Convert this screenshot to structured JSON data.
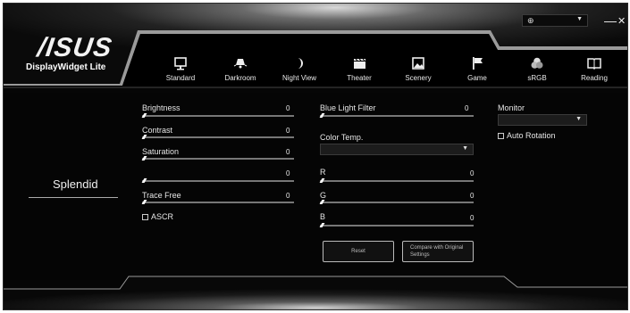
{
  "app": {
    "logo": "/ISUS",
    "title": "DisplayWidget Lite",
    "language_icon": "globe-icon"
  },
  "window": {
    "minimize": "—",
    "close": "✕"
  },
  "modes": [
    {
      "label": "Standard",
      "icon": "monitor-icon"
    },
    {
      "label": "Darkroom",
      "icon": "lamp-icon"
    },
    {
      "label": "Night View",
      "icon": "moon-icon"
    },
    {
      "label": "Theater",
      "icon": "clapperboard-icon"
    },
    {
      "label": "Scenery",
      "icon": "picture-icon"
    },
    {
      "label": "Game",
      "icon": "flag-icon"
    },
    {
      "label": "sRGB",
      "icon": "color-wheel-icon"
    },
    {
      "label": "Reading",
      "icon": "book-icon"
    }
  ],
  "sidebar": {
    "label": "Splendid"
  },
  "left_sliders": [
    {
      "label": "Brightness",
      "value": "0"
    },
    {
      "label": "Contrast",
      "value": "0"
    },
    {
      "label": "Saturation",
      "value": "0"
    },
    {
      "label": "",
      "value": "0"
    },
    {
      "label": "Trace Free",
      "value": "0"
    }
  ],
  "ascr": {
    "label": "ASCR",
    "checked": false
  },
  "blue_light": {
    "label": "Blue Light Filter",
    "value": "0"
  },
  "color_temp": {
    "label": "Color Temp.",
    "selected": ""
  },
  "rgb": [
    {
      "label": "R",
      "value": "0"
    },
    {
      "label": "G",
      "value": "0"
    },
    {
      "label": "B",
      "value": "0"
    }
  ],
  "buttons": {
    "reset": "Reset",
    "compare_line1": "Compare with Original",
    "compare_line2": "Settings"
  },
  "monitor": {
    "label": "Monitor",
    "selected": "",
    "auto_rotation": "Auto Rotation"
  }
}
